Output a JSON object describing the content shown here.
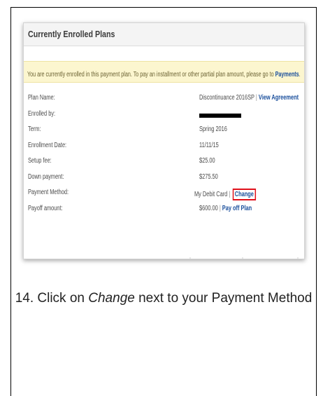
{
  "panel": {
    "title": "Currently Enrolled Plans",
    "notice_text": "You are currently enrolled in this payment plan. To pay an installment or other partial plan amount, please go to",
    "notice_link": "Payments",
    "notice_end": "."
  },
  "fields": {
    "plan_name": {
      "label": "Plan Name:",
      "value": "Discontinuance 2016SP",
      "link": "View Agreement"
    },
    "enrolled_by": {
      "label": "Enrolled by:"
    },
    "term": {
      "label": "Term:",
      "value": "Spring 2016"
    },
    "enrollment_date": {
      "label": "Enrollment Date:",
      "value": "11/11/15"
    },
    "setup_fee": {
      "label": "Setup fee:",
      "value": "$25.00"
    },
    "down_payment": {
      "label": "Down payment:",
      "value": "$275.50"
    },
    "payment_method": {
      "label": "Payment Method:",
      "value": "My Debit Card",
      "separator": "|",
      "link": "Change"
    },
    "payoff_amount": {
      "label": "Payoff amount:",
      "value": "$600.00",
      "separator": "|",
      "link": "Pay off Plan"
    }
  },
  "separator": "|",
  "caption": {
    "prefix": "14. Click on",
    "emphasis": "Change",
    "suffix": "next to your Payment Method"
  },
  "colors": {
    "link": "#1a4f9c",
    "highlight_box": "#e0101a",
    "notice_bg": "#fcf6cf"
  }
}
